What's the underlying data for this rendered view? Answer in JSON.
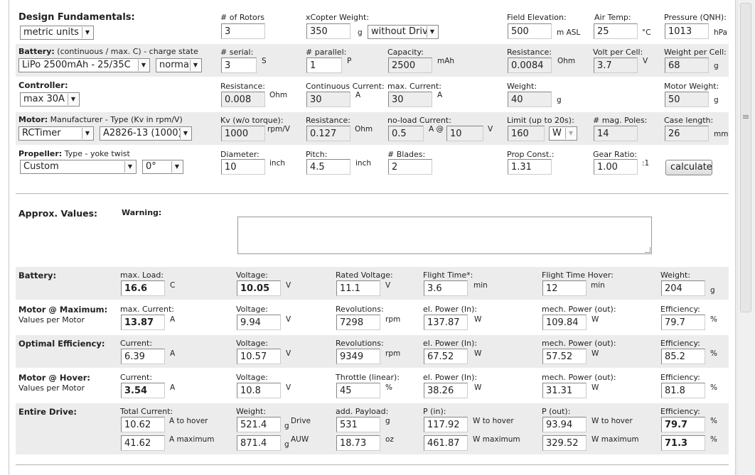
{
  "design": {
    "title": "Design Fundamentals:",
    "units": "metric units",
    "rotors_label": "# of Rotors",
    "rotors": "3",
    "weight_label": "xCopter Weight:",
    "weight": "350",
    "weight_unit": "g",
    "drive_option": "without Drive",
    "elev_label": "Field Elevation:",
    "elev": "500",
    "elev_unit": "m ASL",
    "temp_label": "Air Temp:",
    "temp": "25",
    "temp_unit": "°C",
    "pressure_label": "Pressure (QNH):",
    "pressure": "1013",
    "pressure_unit": "hPa"
  },
  "battery": {
    "title": "Battery:",
    "title_suffix": "(continuous / max. C) - charge state",
    "type": "LiPo 2500mAh - 25/35C",
    "state": "normal",
    "serial_label": "# serial:",
    "serial": "3",
    "serial_unit": "S",
    "parallel_label": "# parallel:",
    "parallel": "1",
    "parallel_unit": "P",
    "capacity_label": "Capacity:",
    "capacity": "2500",
    "capacity_unit": "mAh",
    "resistance_label": "Resistance:",
    "resistance": "0.0084",
    "resistance_unit": "Ohm",
    "vcell_label": "Volt per Cell:",
    "vcell": "3.7",
    "vcell_unit": "V",
    "wcell_label": "Weight per Cell:",
    "wcell": "68",
    "wcell_unit": "g"
  },
  "controller": {
    "title": "Controller:",
    "type": "max 30A",
    "resistance_label": "Resistance:",
    "resistance": "0.008",
    "resistance_unit": "Ohm",
    "cont_label": "Continuous Current:",
    "cont": "30",
    "cont_unit": "A",
    "max_label": "max. Current:",
    "max": "30",
    "max_unit": "A",
    "weight_label": "Weight:",
    "weight": "40",
    "weight_unit": "g",
    "mweight_label": "Motor Weight:",
    "mweight": "50",
    "mweight_unit": "g"
  },
  "motor": {
    "title": "Motor:",
    "title_suffix": "Manufacturer - Type (Kv in rpm/V)",
    "manufacturer": "RCTimer",
    "type": "A2826-13 (1000)",
    "kv_label": "Kv (w/o torque):",
    "kv": "1000",
    "kv_unit": "rpm/V",
    "resistance_label": "Resistance:",
    "resistance": "0.127",
    "resistance_unit": "Ohm",
    "noload_label": "no-load Current:",
    "noload": "0.5",
    "noload_at": "A @",
    "noload_v": "10",
    "noload_v_unit": "V",
    "limit_label": "Limit (up to 20s):",
    "limit": "160",
    "limit_unit": "W",
    "poles_label": "# mag. Poles:",
    "poles": "14",
    "case_label": "Case length:",
    "case": "26",
    "case_unit": "mm"
  },
  "propeller": {
    "title": "Propeller:",
    "title_suffix": "Type - yoke twist",
    "type": "Custom",
    "twist": "0°",
    "diameter_label": "Diameter:",
    "diameter": "10",
    "diameter_unit": "inch",
    "pitch_label": "Pitch:",
    "pitch": "4.5",
    "pitch_unit": "inch",
    "blades_label": "# Blades:",
    "blades": "2",
    "const_label": "Prop Const.:",
    "const": "1.31",
    "gear_label": "Gear Ratio:",
    "gear": "1.00",
    "gear_unit": ":1",
    "calc": "calculate"
  },
  "approx": {
    "title": "Approx. Values:",
    "warning": "Warning:"
  },
  "res_battery": {
    "title": "Battery:",
    "load_label": "max. Load:",
    "load": "16.6",
    "load_unit": "C",
    "voltage_label": "Voltage:",
    "voltage": "10.05",
    "voltage_unit": "V",
    "rated_label": "Rated Voltage:",
    "rated": "11.1",
    "rated_unit": "V",
    "flight_label": "Flight Time*:",
    "flight": "3.6",
    "flight_unit": "min",
    "hover_label": "Flight Time Hover:",
    "hover": "12",
    "hover_unit": "min",
    "weight_label": "Weight:",
    "weight": "204",
    "weight_unit": "g"
  },
  "res_max": {
    "title": "Motor @ Maximum:",
    "subtitle": "Values per Motor",
    "current_label": "max. Current:",
    "current": "13.87",
    "current_unit": "A",
    "voltage_label": "Voltage:",
    "voltage": "9.94",
    "voltage_unit": "V",
    "rev_label": "Revolutions:",
    "rev": "7298",
    "rev_unit": "rpm",
    "pin_label": "el. Power (In):",
    "pin": "137.87",
    "pin_unit": "W",
    "pout_label": "mech. Power (out):",
    "pout": "109.84",
    "pout_unit": "W",
    "eff_label": "Efficiency:",
    "eff": "79.7",
    "eff_unit": "%"
  },
  "res_opt": {
    "title": "Optimal Efficiency:",
    "current_label": "Current:",
    "current": "6.39",
    "current_unit": "A",
    "voltage_label": "Voltage:",
    "voltage": "10.57",
    "voltage_unit": "V",
    "rev_label": "Revolutions:",
    "rev": "9349",
    "rev_unit": "rpm",
    "pin_label": "el. Power (In):",
    "pin": "67.52",
    "pin_unit": "W",
    "pout_label": "mech. Power (out):",
    "pout": "57.52",
    "pout_unit": "W",
    "eff_label": "Efficiency:",
    "eff": "85.2",
    "eff_unit": "%"
  },
  "res_hover": {
    "title": "Motor @ Hover:",
    "subtitle": "Values per Motor",
    "current_label": "Current:",
    "current": "3.54",
    "current_unit": "A",
    "voltage_label": "Voltage:",
    "voltage": "10.8",
    "voltage_unit": "V",
    "throttle_label": "Throttle (linear):",
    "throttle": "45",
    "throttle_unit": "%",
    "pin_label": "el. Power (In):",
    "pin": "38.26",
    "pin_unit": "W",
    "pout_label": "mech. Power (out):",
    "pout": "31.31",
    "pout_unit": "W",
    "eff_label": "Efficiency:",
    "eff": "81.8",
    "eff_unit": "%"
  },
  "res_drive": {
    "title": "Entire Drive:",
    "current_label": "Total Current:",
    "current_hover": "10.62",
    "current_hover_unit": "A to hover",
    "current_max": "41.62",
    "current_max_unit": "A maximum",
    "weight_label": "Weight:",
    "weight_drive": "521.4",
    "weight_drive_unit": "g",
    "weight_drive_tag": "Drive",
    "weight_auw": "871.4",
    "weight_auw_unit": "g",
    "weight_auw_tag": "AUW",
    "payload_label": "add. Payload:",
    "payload_g": "531",
    "payload_g_unit": "g",
    "payload_oz": "18.73",
    "payload_oz_unit": "oz",
    "pin_label": "P (in):",
    "pin_hover": "117.92",
    "pin_hover_unit": "W to hover",
    "pin_max": "461.87",
    "pin_max_unit": "W maximum",
    "pout_label": "P (out):",
    "pout_hover": "93.94",
    "pout_hover_unit": "W to hover",
    "pout_max": "329.52",
    "pout_max_unit": "W maximum",
    "eff_label": "Efficiency:",
    "eff_hover": "79.7",
    "eff_hover_unit": "%",
    "eff_max": "71.3",
    "eff_max_unit": "%"
  }
}
